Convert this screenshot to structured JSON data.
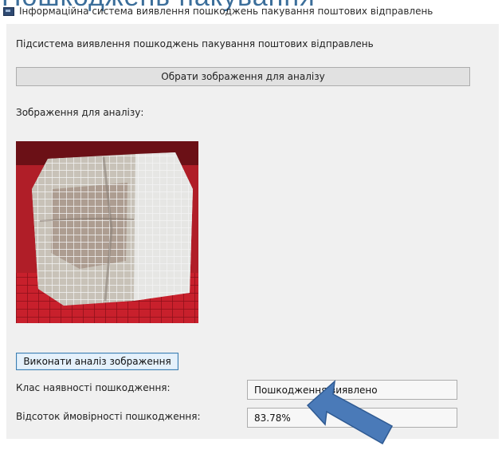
{
  "heading_partial": "Пошкоджень пакування",
  "window": {
    "title": "Інформаційна система виявлення пошкоджень пакування поштових відправлень"
  },
  "subsystem_label": "Підсистема виявлення пошкоджень пакування поштових відправлень",
  "select_button_label": "Обрати зображення для аналізу",
  "image_label": "Зображення для аналізу:",
  "analyze_button_label": "Виконати аналіз зображення",
  "result": {
    "class_label": "Клас наявності пошкодження:",
    "class_value": "Пошкодження виявлено",
    "probability_label": "Відсоток ймовірності пошкодження:",
    "probability_value": "83.78%"
  },
  "colors": {
    "arrow": "#4a7ab8",
    "heading": "#3b6e9a",
    "accent_border": "#3c7fb1"
  }
}
